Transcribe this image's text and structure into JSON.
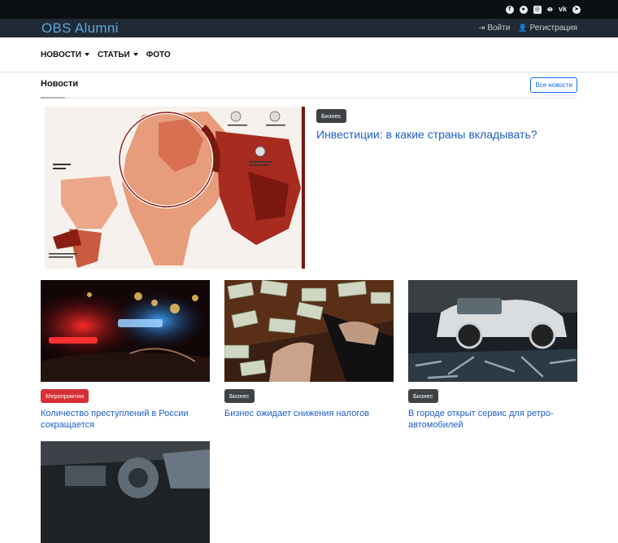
{
  "brand": "OBS Alumni",
  "social": [
    {
      "name": "facebook-icon",
      "glyph": "f",
      "shape": "round"
    },
    {
      "name": "github-icon",
      "glyph": "",
      "shape": "round"
    },
    {
      "name": "instagram-icon",
      "glyph": "",
      "shape": "sq"
    },
    {
      "name": "odnoklassniki-icon",
      "glyph": "ok",
      "shape": "txt"
    },
    {
      "name": "vk-icon",
      "glyph": "vk",
      "shape": "txt"
    },
    {
      "name": "telegram-icon",
      "glyph": "➤",
      "shape": "round"
    }
  ],
  "auth": {
    "login_label": "Войти",
    "login_icon": "sign-in-icon",
    "register_label": "Регистрация",
    "register_icon": "user-plus-icon"
  },
  "nav": {
    "news": "НОВОСТИ",
    "articles": "СТАТЬИ",
    "photo": "ФОТО"
  },
  "section": {
    "title": "Новости",
    "all_button": "Все новости"
  },
  "featured": {
    "category": "Бизнес",
    "title": "Инвестиции: в какие страны вкладывать?"
  },
  "cards": [
    {
      "category": "Мероприятия",
      "category_color": "#d62f35",
      "title": "Количество преступлений в России сокращается"
    },
    {
      "category": "Бизнес",
      "category_color": "#3e4246",
      "title": "Бизнес ожидает снижения налогов"
    },
    {
      "category": "Бизнес",
      "category_color": "#3e4246",
      "title": "В городе открыт сервис для ретро-автомобилей"
    }
  ],
  "colors": {
    "topbar": "#0c0f14",
    "brandbar": "#212a35",
    "brand": "#5aa8de",
    "link": "#1e5ec7",
    "accent": "#0d6efd"
  }
}
